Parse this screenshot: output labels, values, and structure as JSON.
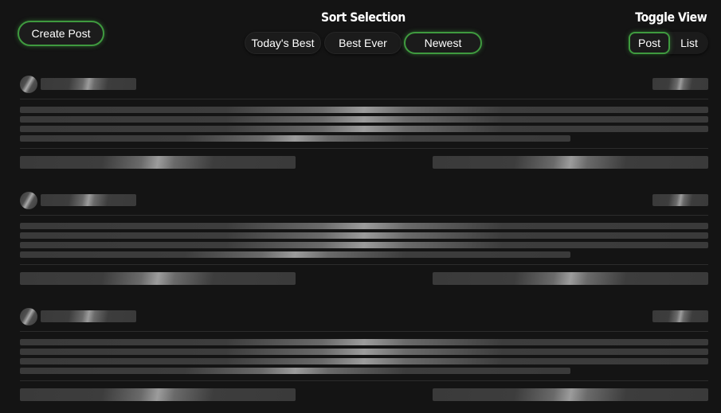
{
  "header": {
    "create_post_label": "Create Post",
    "sort_title": "Sort Selection",
    "toggle_title": "Toggle View"
  },
  "sort_options": [
    {
      "label": "Today's Best",
      "active": false
    },
    {
      "label": "Best Ever",
      "active": false
    },
    {
      "label": "Newest",
      "active": true
    }
  ],
  "view_options": [
    {
      "label": "Post",
      "active": true
    },
    {
      "label": "List",
      "active": false
    }
  ],
  "colors": {
    "accent": "#3f9a3f",
    "background": "#141414",
    "skeleton": "#3a3a3a"
  },
  "feed": {
    "state": "loading",
    "placeholder_cards": [
      {
        "id": "card-1"
      },
      {
        "id": "card-2"
      },
      {
        "id": "card-3"
      }
    ]
  }
}
